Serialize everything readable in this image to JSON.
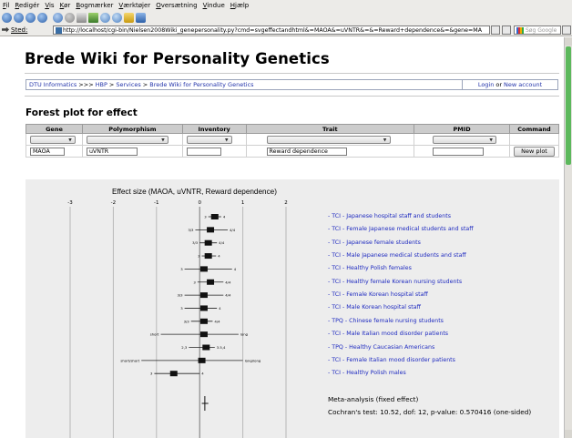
{
  "browser": {
    "menu": [
      "Fil",
      "Redigér",
      "Vis",
      "Kør",
      "Bogmærker",
      "Værktøjer",
      "Oversætning",
      "Vindue",
      "Hjælp"
    ],
    "address_label": "Sted:",
    "url": "http://localhost/cgi-bin/Nielsen2008Wiki_genepersonality.py?cmd=svgeffectandhtml&=MAOA&=uVNTR&=&=Reward+dependence&=&gene=MA",
    "search_placeholder": "Søg Google"
  },
  "site": {
    "title": "Brede Wiki for Personality Genetics"
  },
  "breadcrumb": {
    "items": [
      "DTU Informatics",
      "HBP",
      "Services",
      "Brede Wiki for Personality Genetics"
    ],
    "separators": [
      ">>>",
      ">",
      ">"
    ],
    "login": "Login",
    "or": "or",
    "new_account": "New account"
  },
  "section": {
    "title": "Forest plot for effect"
  },
  "form": {
    "headers": [
      "Gene",
      "Polymorphism",
      "Inventory",
      "Trait",
      "PMID",
      "Command"
    ],
    "values": {
      "gene": "MAOA",
      "polymorphism": "uVNTR",
      "inventory": "",
      "trait": "Reward dependence",
      "pmid": ""
    },
    "button": "New plot"
  },
  "chart_data": {
    "type": "forest",
    "title": "Effect size (MAOA, uVNTR, Reward dependence)",
    "xlim": [
      -3,
      2
    ],
    "ticks": [
      "-3",
      "-2",
      "-1",
      "0",
      "1",
      "2"
    ],
    "gridlines": [
      -3,
      -2,
      -1,
      0,
      1,
      2
    ],
    "studies": [
      {
        "label": "- TCI - Japanese hospital staff and students",
        "effect": 0.35,
        "low": 0.2,
        "high": 0.5,
        "left": "3",
        "right": "4"
      },
      {
        "label": "- TCI - Female Japanese medical students and staff",
        "effect": 0.25,
        "low": -0.1,
        "high": 0.65,
        "left": "3/3",
        "right": "4/4"
      },
      {
        "label": "- TCI - Japanese female students",
        "effect": 0.2,
        "low": 0.0,
        "high": 0.4,
        "left": "3/3",
        "right": "4/4"
      },
      {
        "label": "- TCI - Male Japanese medical students and staff",
        "effect": 0.2,
        "low": 0.05,
        "high": 0.38,
        "left": "3",
        "right": "4"
      },
      {
        "label": "- TCI - Healthy Polish females",
        "effect": 0.1,
        "low": -0.35,
        "high": 0.75,
        "left": "3",
        "right": "4"
      },
      {
        "label": "- TCI - Healthy female Korean nursing students",
        "effect": 0.25,
        "low": -0.05,
        "high": 0.55,
        "left": "3",
        "right": "4/4"
      },
      {
        "label": "- TCI - Female Korean hospital staff",
        "effect": 0.1,
        "low": -0.35,
        "high": 0.55,
        "left": "3/3",
        "right": "4/4"
      },
      {
        "label": "- TCI - Male Korean hospital staff",
        "effect": 0.1,
        "low": -0.35,
        "high": 0.4,
        "left": "3",
        "right": "4"
      },
      {
        "label": "- TPQ - Chinese female nursing students",
        "effect": 0.1,
        "low": -0.2,
        "high": 0.3,
        "left": "3/3",
        "right": "4/4"
      },
      {
        "label": "- TCI - Male Italian mood disorder patients",
        "effect": 0.1,
        "low": -0.9,
        "high": 0.9,
        "left": "short",
        "right": "long"
      },
      {
        "label": "- TPQ - Healthy Caucasian Americans",
        "effect": 0.15,
        "low": -0.25,
        "high": 0.35,
        "left": "2,3",
        "right": "3.5,4"
      },
      {
        "label": "- TCI - Female Italian mood disorder patients",
        "effect": 0.05,
        "low": -1.35,
        "high": 1.0,
        "left": "short/short",
        "right": "long/long"
      },
      {
        "label": "- TCI - Healthy Polish males",
        "effect": -0.6,
        "low": -1.05,
        "high": 0.0,
        "left": "3",
        "right": "4"
      }
    ],
    "meta": {
      "effect": 0.12,
      "low": 0.05,
      "high": 0.2,
      "title": "Meta-analysis (fixed effect)",
      "stats": "Cochran's test: 10.52, dof: 12, p-value: 0.570416 (one-sided)"
    }
  }
}
